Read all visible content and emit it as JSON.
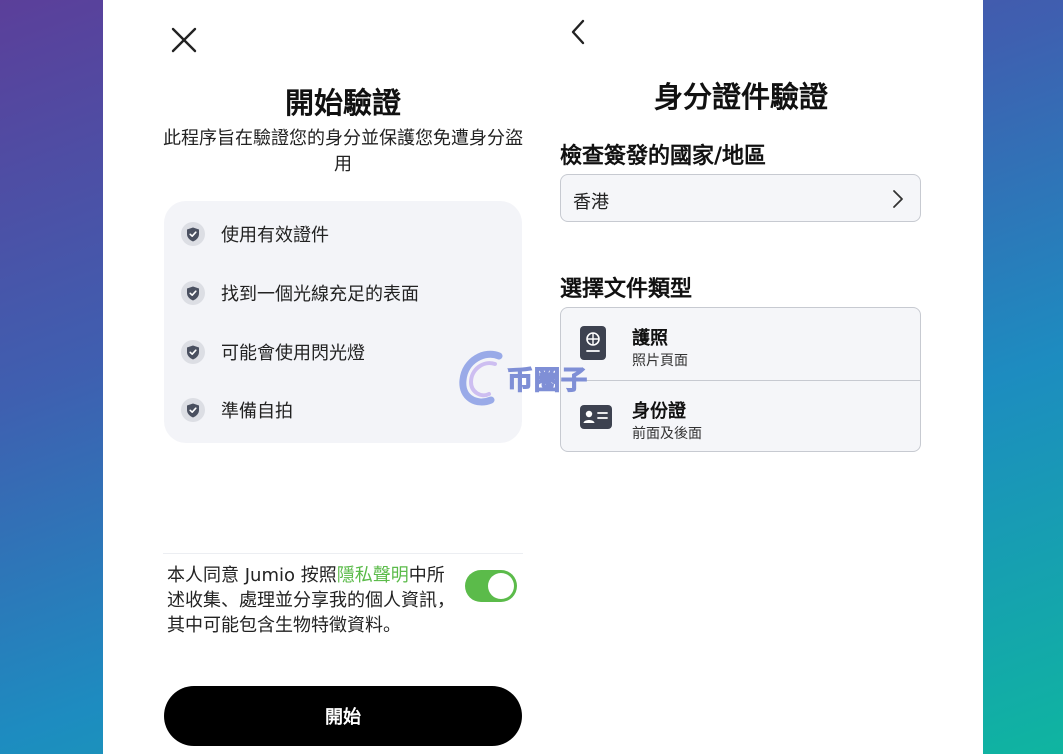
{
  "start_screen": {
    "title": "開始驗證",
    "subtitle": "此程序旨在驗證您的身分並保護您免遭身分盜用",
    "checklist": [
      {
        "label": "使用有效證件"
      },
      {
        "label": "找到一個光線充足的表面"
      },
      {
        "label": "可能會使用閃光燈"
      },
      {
        "label": "準備自拍"
      }
    ],
    "consent": {
      "prefix": "本人同意 Jumio 按照",
      "link": "隱私聲明",
      "suffix": "中所述收集、處理並分享我的個人資訊，其中可能包含生物特徵資料。"
    },
    "toggle_on": true,
    "start_button": "開始"
  },
  "id_screen": {
    "title": "身分證件驗證",
    "country_label": "檢查簽發的國家/地區",
    "country_value": "香港",
    "doc_type_label": "選擇文件類型",
    "doc_types": [
      {
        "title": "護照",
        "subtitle": "照片頁面",
        "icon": "passport-icon"
      },
      {
        "title": "身份證",
        "subtitle": "前面及後面",
        "icon": "id-card-icon"
      }
    ]
  },
  "watermark": {
    "text": "币圈子"
  },
  "colors": {
    "accent_green": "#5bbb4a",
    "button_black": "#000000",
    "card_bg": "#f3f4f8",
    "border": "#c7cad1"
  }
}
